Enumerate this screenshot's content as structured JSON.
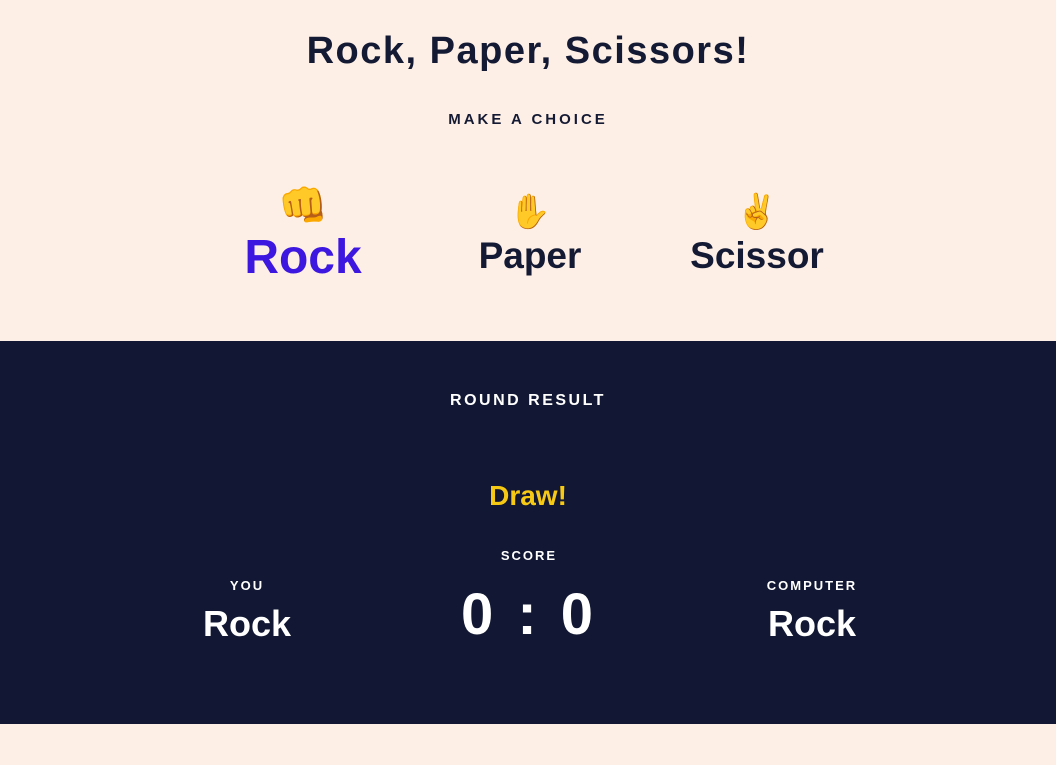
{
  "header": {
    "title": "Rock, Paper, Scissors!",
    "subtitle": "MAKE A CHOICE"
  },
  "choices": [
    {
      "icon": "fist-icon",
      "emoji": "👊",
      "label": "Rock",
      "selected": true,
      "color": "#3d17e0"
    },
    {
      "icon": "raised-hand-icon",
      "emoji": "✋",
      "label": "Paper",
      "selected": false,
      "color": "#141a33"
    },
    {
      "icon": "victory-hand-icon",
      "emoji": "✌️",
      "label": "Scissor",
      "selected": false,
      "color": "#141a33"
    }
  ],
  "results": {
    "title": "ROUND RESULT",
    "outcome": "Draw!",
    "outcome_color": "#f6c915",
    "you": {
      "heading": "YOU",
      "choice": "Rock"
    },
    "score": {
      "heading": "SCORE",
      "value": "0 : 0"
    },
    "computer": {
      "heading": "COMPUTER",
      "choice": "Rock"
    }
  },
  "colors": {
    "background": "#fdefe6",
    "panel": "#121833",
    "text_dark": "#141a33",
    "accent": "#3d17e0"
  }
}
